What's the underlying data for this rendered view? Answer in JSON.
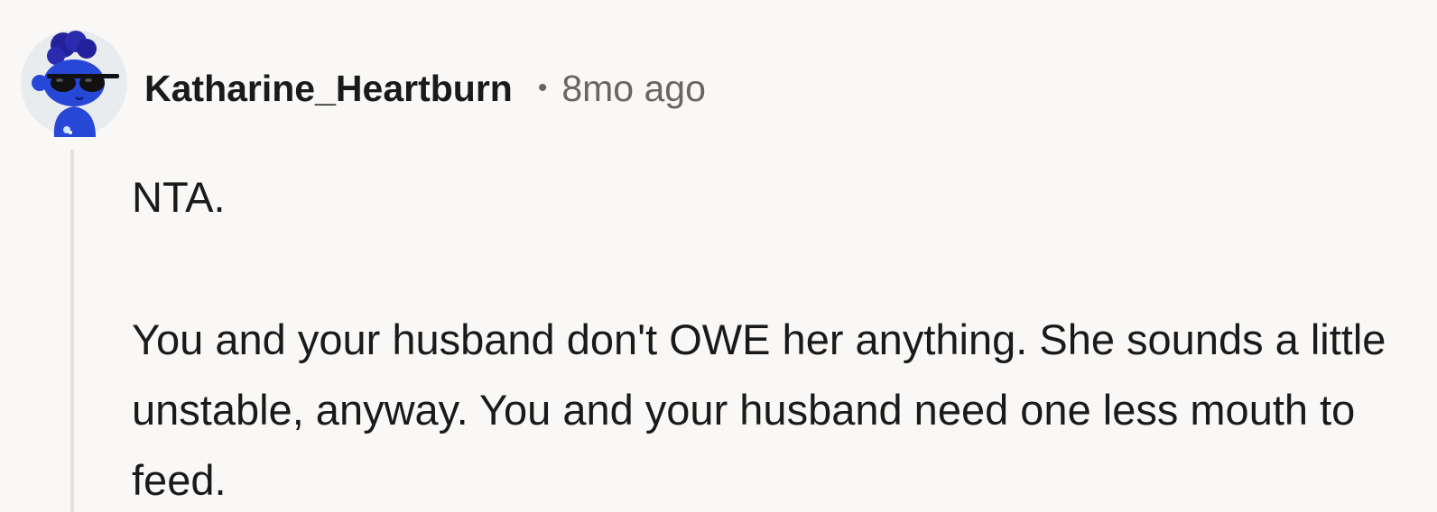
{
  "comment": {
    "author": "Katharine_Heartburn",
    "separator": "•",
    "timestamp": "8mo ago",
    "paragraphs": [
      "NTA.",
      "You and your husband don't OWE her anything. She sounds a little unstable, anyway. You and your husband need one less mouth to feed."
    ],
    "avatar": {
      "icon": "snoo-avatar-icon",
      "description_colors": {
        "skin": "#2747d6",
        "hair": "#23229a",
        "sunglasses": "#111111",
        "background": "#e9ecef"
      }
    }
  },
  "colors": {
    "background": "#f9f8f6",
    "text": "#1a1a1a",
    "meta": "#6b6560",
    "thread_line": "#e3e1dc"
  }
}
